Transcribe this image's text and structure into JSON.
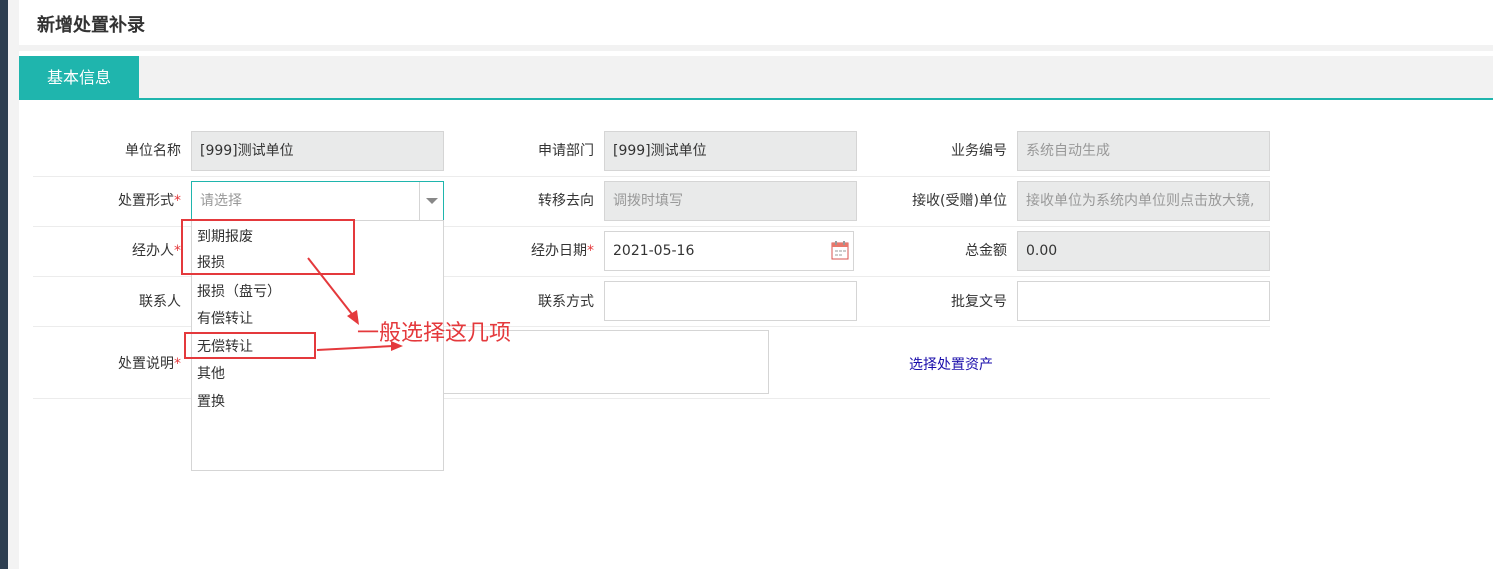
{
  "page_title": "新增处置补录",
  "tab_label": "基本信息",
  "labels": {
    "unit_name": "单位名称",
    "apply_dept": "申请部门",
    "biz_no": "业务编号",
    "dispose_form": "处置形式",
    "transfer_to": "转移去向",
    "receiver": "接收(受赠)单位",
    "handler": "经办人",
    "handle_date": "经办日期",
    "total_amount": "总金额",
    "contact": "联系人",
    "contact_way": "联系方式",
    "approval_no": "批复文号",
    "dispose_note": "处置说明"
  },
  "required_mark": "*",
  "values": {
    "unit_name": "[999]测试单位",
    "apply_dept": "[999]测试单位",
    "biz_no_placeholder": "系统自动生成",
    "dispose_form_placeholder": "请选择",
    "transfer_to_placeholder": "调拨时填写",
    "receiver_placeholder": "接收单位为系统内单位则点击放大镜,",
    "handle_date": "2021-05-16",
    "total_amount": "0.00",
    "contact_way": "",
    "approval_no": ""
  },
  "dropdown_options": [
    "到期报废",
    "报损",
    "报损（盘亏）",
    "有偿转让",
    "无偿转让",
    "其他",
    "置换"
  ],
  "select_assets_link": "选择处置资产",
  "annotation_text": "一般选择这几项",
  "colors": {
    "accent": "#1fb5ad",
    "annotation": "#e4393c",
    "link": "#1a0dab"
  }
}
